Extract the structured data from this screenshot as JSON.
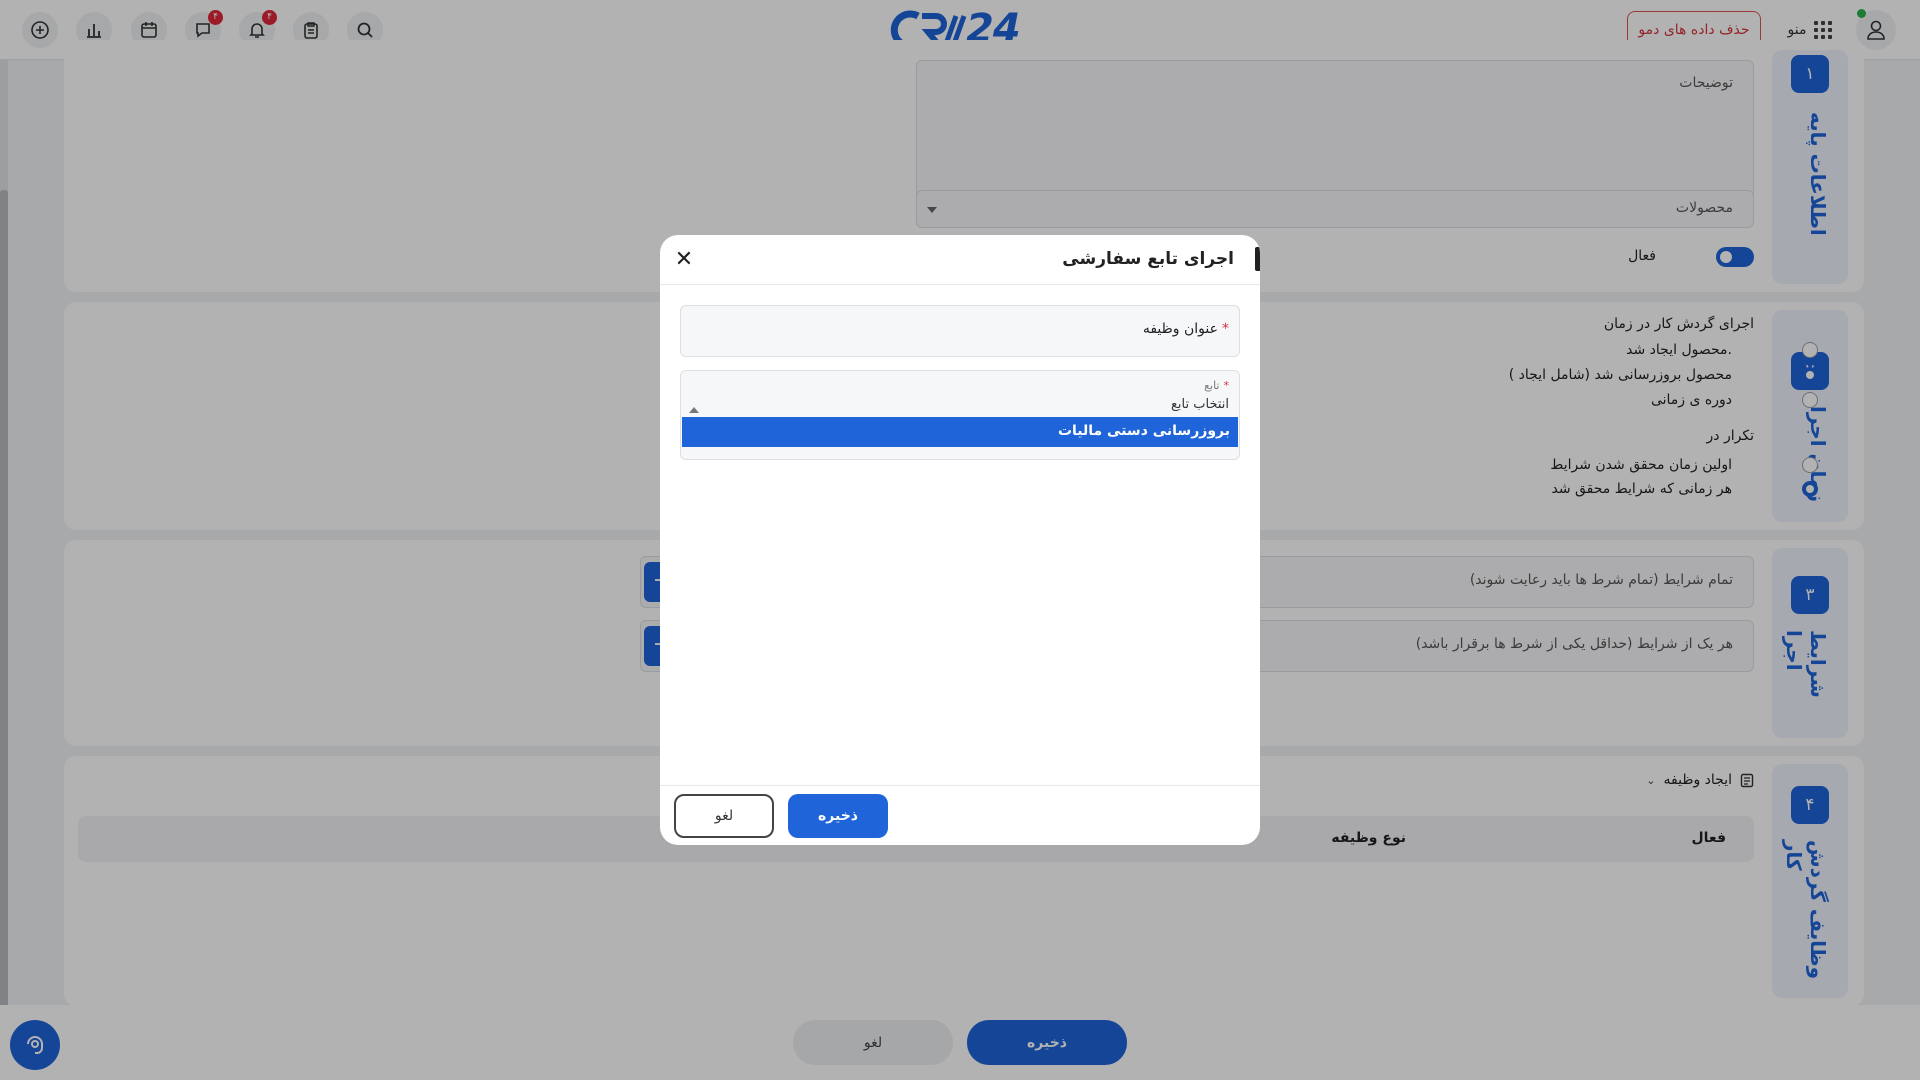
{
  "header": {
    "logo_text": "24",
    "demo_button": "حذف داده های دمو",
    "menu_label": "منو",
    "badges": {
      "chat": "۴",
      "notifications": "۴"
    }
  },
  "sections": {
    "basic": {
      "number": "۱",
      "title": "اطلاعات پایه",
      "description_placeholder": "توضیحات",
      "products_placeholder": "محصولات",
      "active_label": "فعال"
    },
    "timing": {
      "number": "۲",
      "title": "زمان اجرا",
      "run_heading": "اجرای گردش کار در زمان",
      "run_options": [
        {
          "label": "محصول ایجاد شد.",
          "selected": false
        },
        {
          "label": "محصول بروزرسانی شد (شامل ایجاد )",
          "selected": true
        },
        {
          "label": "دوره ی زمانی",
          "selected": false
        }
      ],
      "repeat_heading": "تکرار در",
      "repeat_options": [
        {
          "label": "اولین زمان محقق شدن شرایط",
          "selected": false
        },
        {
          "label": "هر زمانی که شرایط محقق شد",
          "selected": true
        }
      ]
    },
    "conditions": {
      "number": "۳",
      "title": "شرایط اجرا",
      "all_conditions": "تمام شرایط (تمام شرط ها باید رعایت شوند)",
      "any_conditions": "هر یک از شرایط (حداقل یکی از شرط ها برقرار باشد)",
      "add_symbol": "+"
    },
    "tasks": {
      "number": "۴",
      "title": "وظایف گردش کار",
      "create_task": "ایجاد وظیفه",
      "columns": [
        "فعال",
        "نوع وظیفه"
      ]
    }
  },
  "footer": {
    "save": "ذخیره",
    "cancel": "لغو"
  },
  "modal": {
    "title": "اجرای تابع سفارشی",
    "close_symbol": "✕",
    "task_title_label": "عنوان وظیفه",
    "required_mark": "*",
    "function_label": "تابع",
    "function_placeholder": "انتخاب تابع",
    "function_options": [
      "بروزرسانی دستی مالیات"
    ],
    "save": "ذخیره",
    "cancel": "لغو"
  },
  "colors": {
    "primary": "#1f64d8",
    "danger": "#d6353c",
    "badge": "#e0283c",
    "online": "#28b24b"
  }
}
